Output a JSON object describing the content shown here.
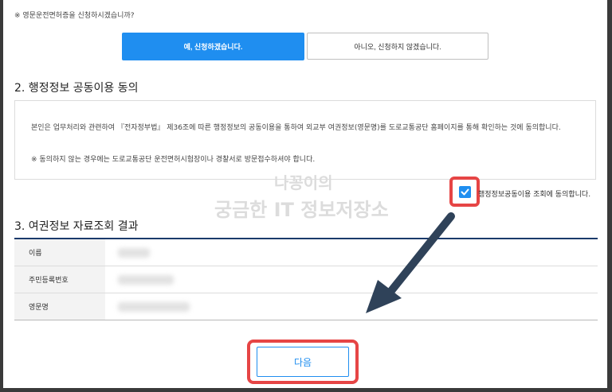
{
  "notice": "※ 영문운전면허증을 신청하시겠습니까?",
  "buttons": {
    "yes": "예, 신청하겠습니다.",
    "no": "아니오, 신청하지 않겠습니다.",
    "next": "다음"
  },
  "section2": {
    "title": "2. 행정정보 공동이용 동의",
    "body": "본인은 업무처리와 관련하여 『전자정부법』 제36조에 따른 행정정보의 공동이용을 통하여 외교부 여권정보(영문명)를 도로교통공단 홈페이지를 통해 확인하는 것에 동의합니다.",
    "note": "※ 동의하지 않는 경우에는 도로교통공단 운전면허시험장이나 경찰서로 방문접수하셔야 합니다.",
    "agree_label": "행정정보공동이용 조회에 동의합니다.",
    "agree_checked": true
  },
  "section3": {
    "title": "3. 여권정보 자료조회 결과",
    "rows": [
      {
        "label": "이름"
      },
      {
        "label": "주민등록번호"
      },
      {
        "label": "영문명"
      }
    ]
  },
  "watermark": {
    "line1": "나꽁이의",
    "line2": "궁금한 IT 정보저장소"
  },
  "colors": {
    "accent": "#1f8ef0",
    "highlight": "#e64545",
    "arrow": "#2f4259",
    "table_top": "#1a3a6b"
  },
  "icons": {
    "checkbox": "check-icon",
    "annotation_arrow": "arrow-down-left-icon"
  }
}
